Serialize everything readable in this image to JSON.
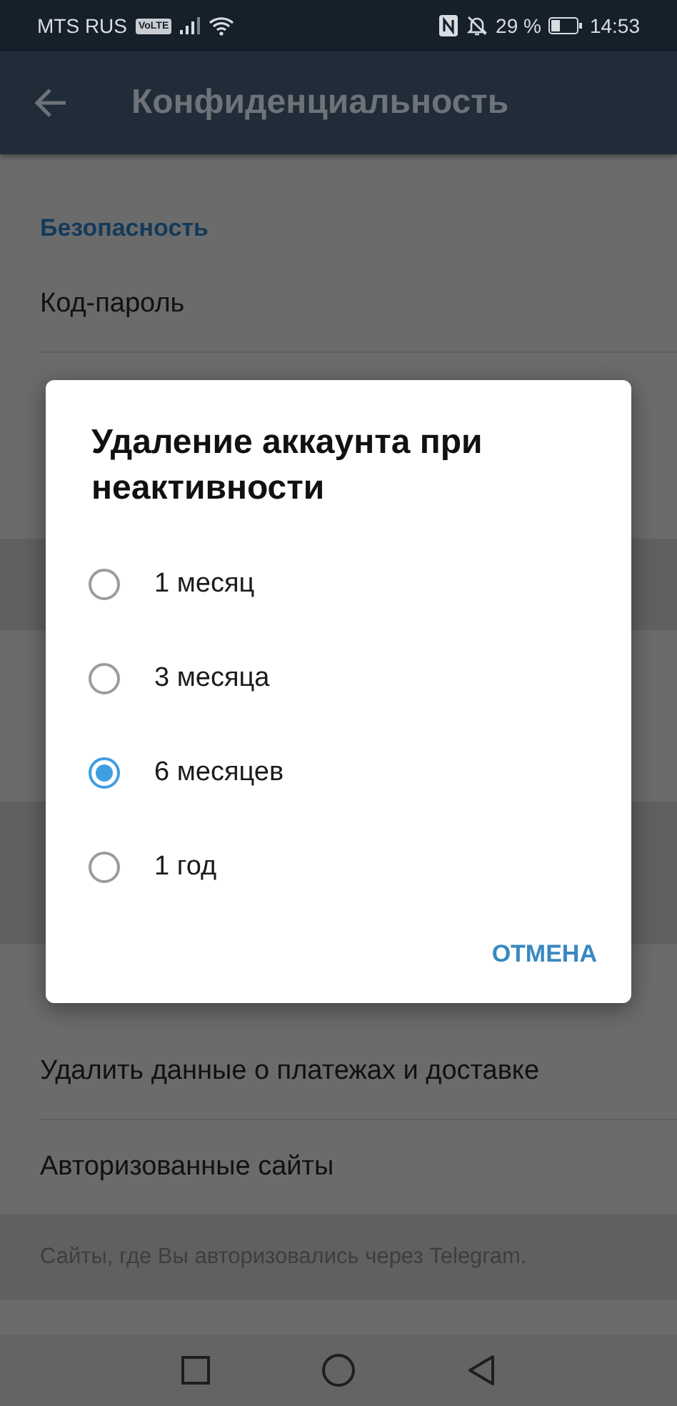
{
  "status_bar": {
    "carrier": "MTS RUS",
    "volte": "VoLTE",
    "battery": "29 %",
    "time": "14:53"
  },
  "header": {
    "title": "Конфиденциальность"
  },
  "sections": [
    {
      "title": "Безопасность",
      "items": [
        "Код-пароль"
      ]
    }
  ],
  "lower_items": [
    "Удалить данные о платежах и доставке",
    "Авторизованные сайты"
  ],
  "lower_hint": "Сайты, где Вы авторизовались через Telegram.",
  "dialog": {
    "title": "Удаление аккаунта при неактивности",
    "options": [
      {
        "label": "1 месяц",
        "selected": false
      },
      {
        "label": "3 месяца",
        "selected": false
      },
      {
        "label": "6 месяцев",
        "selected": true
      },
      {
        "label": "1 год",
        "selected": false
      }
    ],
    "cancel": "ОТМЕНА"
  }
}
